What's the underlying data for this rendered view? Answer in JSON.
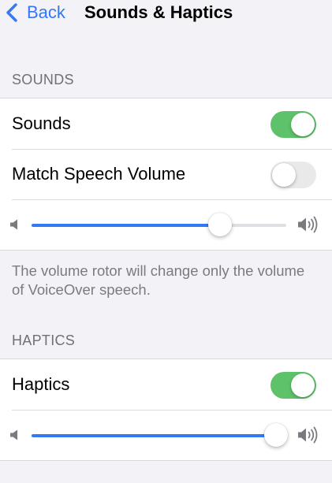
{
  "nav": {
    "back_label": "Back",
    "title": "Sounds & Haptics"
  },
  "sounds_section": {
    "header": "SOUNDS",
    "sounds_label": "Sounds",
    "sounds_on": true,
    "match_label": "Match Speech Volume",
    "match_on": false,
    "volume_level": 0.74,
    "footer": "The volume rotor will change only the volume of VoiceOver speech."
  },
  "haptics_section": {
    "header": "HAPTICS",
    "haptics_label": "Haptics",
    "haptics_on": true,
    "haptics_level": 0.96
  },
  "colors": {
    "accent": "#3478f6",
    "toggle_on": "#5ec26a",
    "toggle_off": "#e9e9ea"
  },
  "icons": [
    "chevron-left-icon",
    "speaker-low-icon",
    "speaker-high-icon"
  ]
}
